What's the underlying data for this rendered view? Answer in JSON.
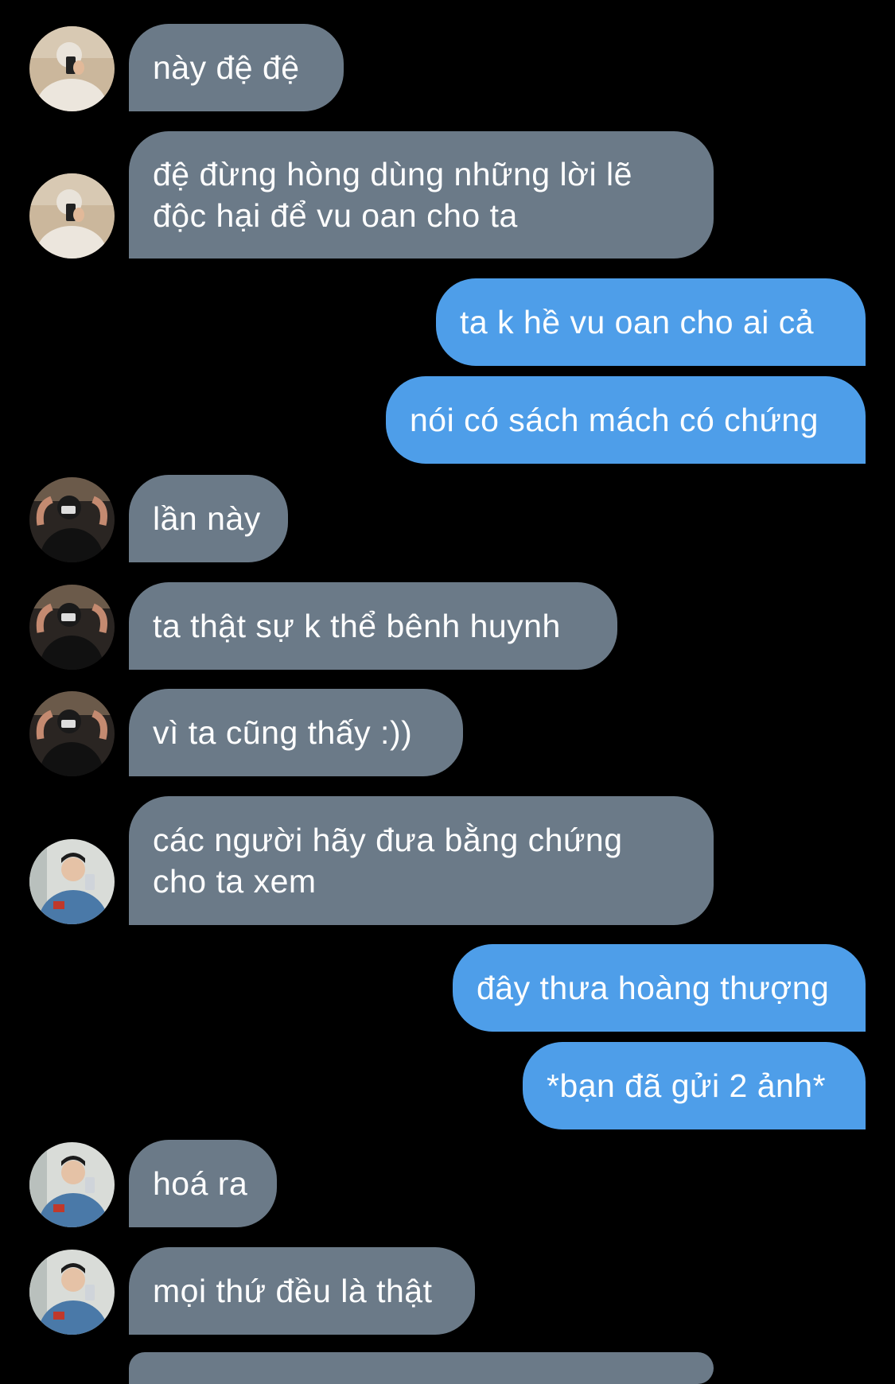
{
  "messages": [
    {
      "side": "in",
      "avatar": "avatar-a",
      "text": "này đệ đệ"
    },
    {
      "side": "in",
      "avatar": "avatar-a",
      "text": "đệ đừng hòng dùng những lời lẽ độc hại để vu oan cho ta"
    },
    {
      "side": "out",
      "text": "ta k hề vu oan cho ai cả"
    },
    {
      "side": "out",
      "text": "nói có sách mách có chứng"
    },
    {
      "side": "in",
      "avatar": "avatar-b",
      "text": "lần này"
    },
    {
      "side": "in",
      "avatar": "avatar-b",
      "text": "ta thật sự k thể bênh huynh"
    },
    {
      "side": "in",
      "avatar": "avatar-b",
      "text": "vì ta cũng thấy :))"
    },
    {
      "side": "in",
      "avatar": "avatar-c",
      "text": "các người hãy đưa bằng chứng cho ta xem"
    },
    {
      "side": "out",
      "text": "đây thưa hoàng thượng"
    },
    {
      "side": "out",
      "text": "*bạn đã gửi 2 ảnh*"
    },
    {
      "side": "in",
      "avatar": "avatar-c",
      "text": "hoá ra"
    },
    {
      "side": "in",
      "avatar": "avatar-c",
      "text": "mọi thứ đều là thật"
    }
  ],
  "colors": {
    "background": "#000000",
    "incoming_bubble": "#6b7a88",
    "outgoing_bubble": "#4e9ee9",
    "text": "#ffffff"
  }
}
